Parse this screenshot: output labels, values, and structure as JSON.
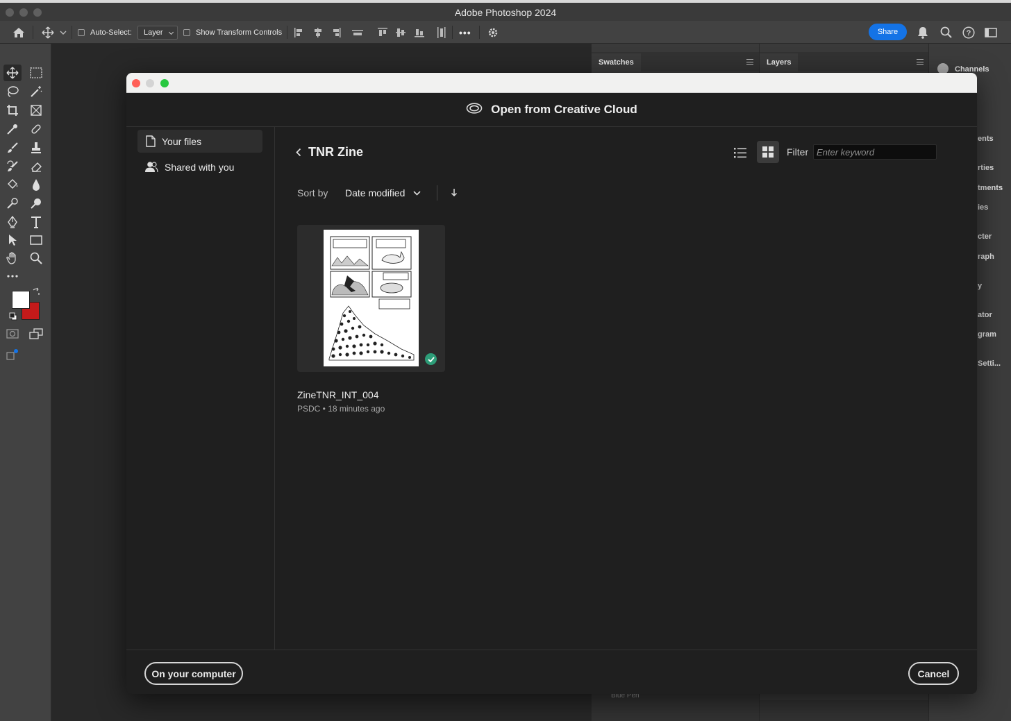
{
  "window": {
    "title": "Adobe Photoshop 2024"
  },
  "options_bar": {
    "auto_select_label": "Auto-Select:",
    "auto_select_target": "Layer",
    "show_transform_label": "Show Transform Controls",
    "share_label": "Share",
    "more_glyph": "•••"
  },
  "panels": {
    "swatches_tab": "Swatches",
    "layers_tab": "Layers",
    "channels_tab": "Channels",
    "collapsed_items": [
      "ents",
      "rties",
      "tments",
      "ies",
      "cter",
      "raph",
      "y",
      "ator",
      "gram",
      "Setti..."
    ],
    "layer_name_partial": "Blue Pen"
  },
  "dialog": {
    "title": "Open from Creative Cloud",
    "sidebar": [
      {
        "label": "Your files",
        "icon": "document-icon",
        "selected": true
      },
      {
        "label": "Shared with you",
        "icon": "people-icon",
        "selected": false
      }
    ],
    "breadcrumb": "TNR Zine",
    "filter_label": "Filter",
    "filter_placeholder": "Enter keyword",
    "sort_label": "Sort by",
    "sort_value": "Date modified",
    "files": [
      {
        "name": "ZineTNR_INT_004",
        "meta": "PSDC • 18 minutes ago",
        "status": "synced"
      }
    ],
    "footer": {
      "computer_button": "On your computer",
      "cancel_button": "Cancel"
    }
  }
}
